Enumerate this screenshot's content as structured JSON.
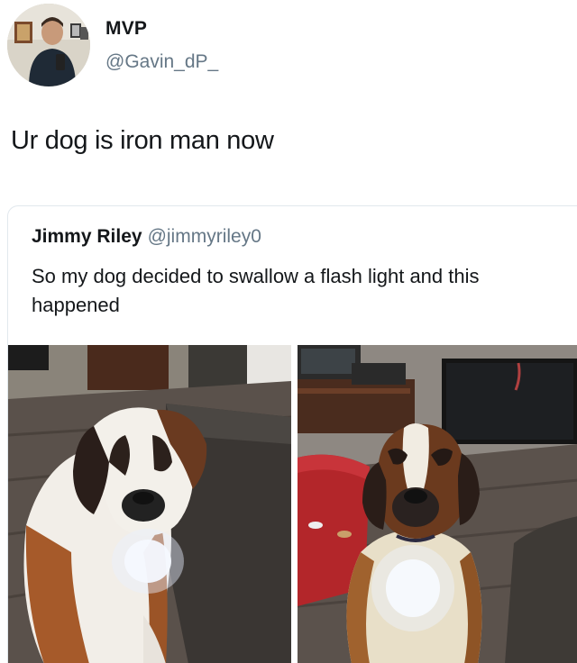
{
  "tweet": {
    "display_name": "MVP",
    "handle": "@Gavin_dP_",
    "text": "Ur dog is iron man now"
  },
  "quoted_tweet": {
    "display_name": "Jimmy Riley",
    "handle": "@jimmyriley0",
    "text": "So my dog decided to swallow a flash light and this happened"
  },
  "media": [
    {
      "icon": "photo-dog-on-floor"
    },
    {
      "icon": "photo-dog-sitting-front"
    }
  ],
  "colors": {
    "primary_text": "#14171a",
    "secondary_text": "#657786",
    "border": "#e1e8ed"
  }
}
